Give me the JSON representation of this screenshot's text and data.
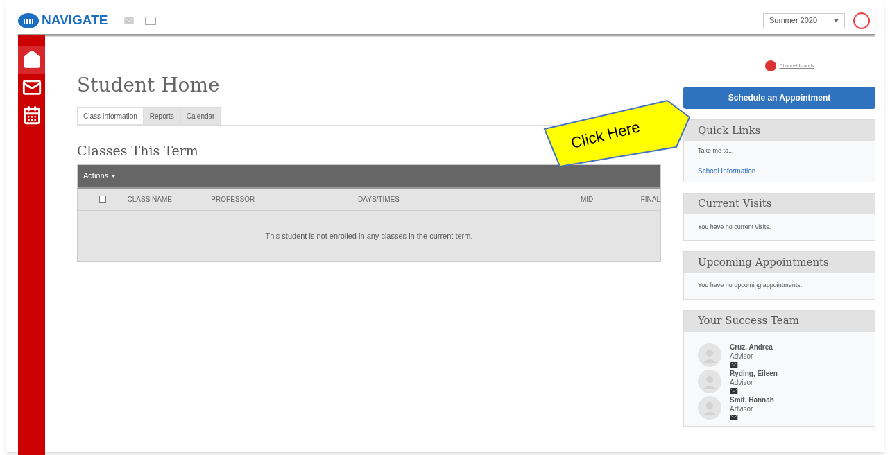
{
  "header": {
    "brand": "NAVIGATE",
    "term": "Summer 2020"
  },
  "sidebar": {
    "items": [
      {
        "kind": "home",
        "selected": true
      },
      {
        "kind": "mail",
        "selected": false
      },
      {
        "kind": "calendar",
        "selected": false
      }
    ]
  },
  "page_title": "Student Home",
  "tabs": [
    {
      "label": "Class Information",
      "selected": true
    },
    {
      "label": "Reports",
      "selected": false
    },
    {
      "label": "Calendar",
      "selected": false
    }
  ],
  "classes": {
    "title": "Classes This Term",
    "actions": "Actions",
    "columns": [
      "CLASS NAME",
      "PROFESSOR",
      "DAYS/TIMES",
      "MID",
      "FINAL"
    ],
    "select_all_checked": false,
    "empty_message": "This student is not enrolled in any classes in the current term."
  },
  "school_logo": "Channel Islands",
  "schedule_button": "Schedule an Appointment",
  "callout": "Click Here",
  "quick_links": {
    "title": "Quick Links",
    "intro": "Take me to...",
    "links": [
      "School Information"
    ]
  },
  "current_visits": {
    "title": "Current Visits",
    "message": "You have no current visits."
  },
  "upcoming_appointments": {
    "title": "Upcoming Appointments",
    "message": "You have no upcoming appointments."
  },
  "success_team": {
    "title": "Your Success Team",
    "members": [
      {
        "name": "Cruz, Andrea",
        "role": "Advisor"
      },
      {
        "name": "Ryding, Eileen",
        "role": "Advisor"
      },
      {
        "name": "Smit, Hannah",
        "role": "Advisor"
      }
    ]
  }
}
